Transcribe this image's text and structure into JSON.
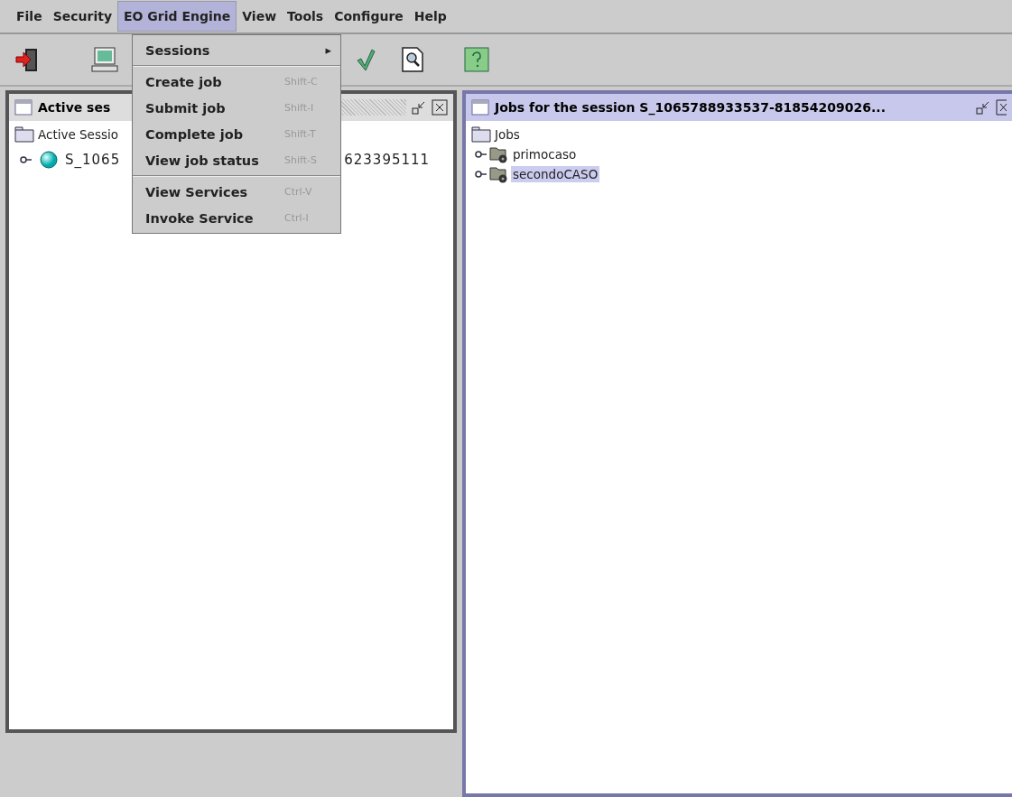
{
  "menubar": [
    {
      "label": "File",
      "selected": false
    },
    {
      "label": "Security",
      "selected": false
    },
    {
      "label": "EO Grid Engine",
      "selected": true
    },
    {
      "label": "View",
      "selected": false
    },
    {
      "label": "Tools",
      "selected": false
    },
    {
      "label": "Configure",
      "selected": false
    },
    {
      "label": "Help",
      "selected": false
    }
  ],
  "menu": {
    "items": [
      {
        "kind": "submenu",
        "label": "Sessions",
        "arrow": "▸"
      },
      {
        "kind": "separator"
      },
      {
        "kind": "item",
        "label": "Create job",
        "shortcut": "Shift-C"
      },
      {
        "kind": "item",
        "label": "Submit job",
        "shortcut": "Shift-I"
      },
      {
        "kind": "item",
        "label": "Complete job",
        "shortcut": "Shift-T"
      },
      {
        "kind": "item",
        "label": "View job status",
        "shortcut": "Shift-S"
      },
      {
        "kind": "separator"
      },
      {
        "kind": "item",
        "label": "View Services",
        "shortcut": "Ctrl-V"
      },
      {
        "kind": "item",
        "label": "Invoke Service",
        "shortcut": "Ctrl-I"
      }
    ]
  },
  "left_panel": {
    "title": "Active ses",
    "active": false,
    "root": "Active Sessio",
    "session_parts": [
      "S_1065",
      "623395111"
    ]
  },
  "right_panel": {
    "title": "Jobs for the session S_1065788933537-81854209026...",
    "active": true,
    "root": "Jobs",
    "children": [
      {
        "label": "primocaso",
        "selected": false
      },
      {
        "label": "secondoCASO",
        "selected": true
      }
    ]
  }
}
